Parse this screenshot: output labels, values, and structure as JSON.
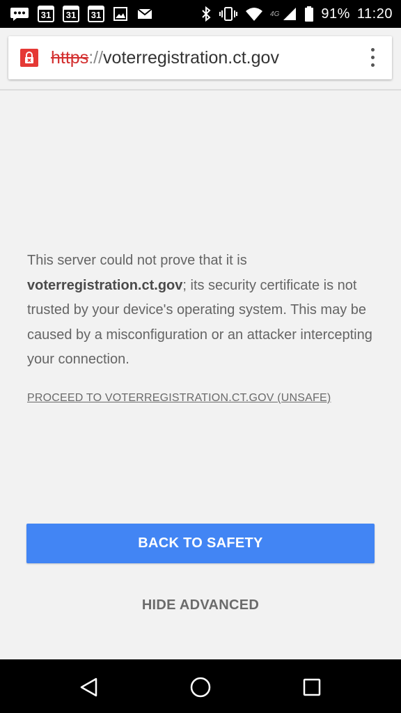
{
  "status_bar": {
    "notifications": [
      "message-icon",
      "calendar-icon",
      "calendar-icon",
      "calendar-icon",
      "image-icon",
      "mail-icon"
    ],
    "calendar_day": "31",
    "network": "4G",
    "battery": "91%",
    "time": "11:20"
  },
  "url_bar": {
    "scheme": "https",
    "separator": "://",
    "host": "voterregistration.ct.gov"
  },
  "interstitial": {
    "message_part1": "This server could not prove that it is ",
    "host_bold": "voterregistration.ct.gov",
    "message_part2": "; its security certificate is not trusted by your device's operating system. This may be caused by a misconfiguration or an attacker intercepting your connection.",
    "proceed_link": "PROCEED TO VOTERREGISTRATION.CT.GOV (UNSAFE)",
    "back_button": "BACK TO SAFETY",
    "hide_advanced": "HIDE ADVANCED"
  },
  "colors": {
    "accent": "#4285f4",
    "danger": "#e53935",
    "background": "#f2f2f2"
  }
}
